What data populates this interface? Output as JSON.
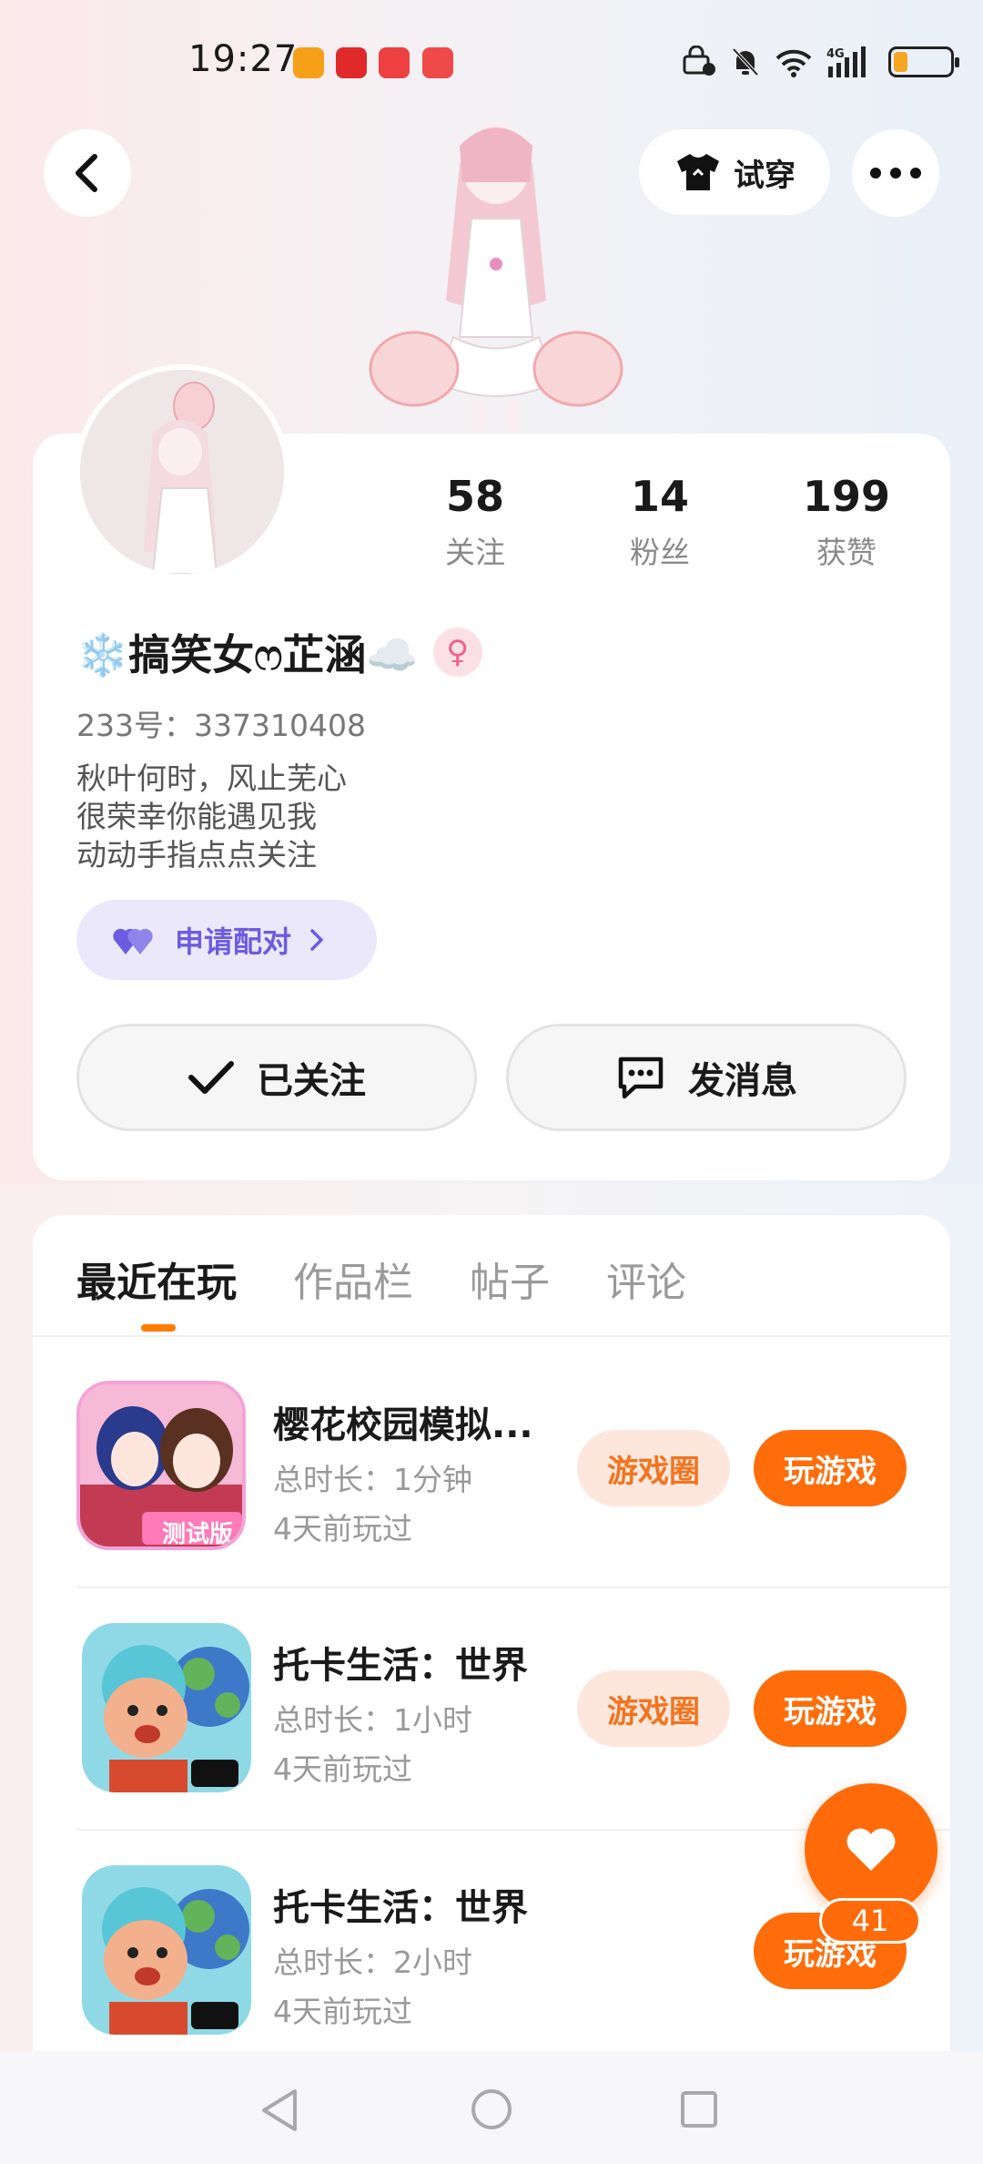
{
  "status_bar": {
    "time": "19:27",
    "battery_level": 0.18,
    "network": "4G"
  },
  "header": {
    "try_on_label": "试穿",
    "icons": {
      "back": "back-arrow-icon",
      "shirt": "shirt-icon",
      "more": "more-icon"
    }
  },
  "profile": {
    "stats": [
      {
        "value": "58",
        "label": "关注"
      },
      {
        "value": "14",
        "label": "粉丝"
      },
      {
        "value": "199",
        "label": "获赞"
      }
    ],
    "nickname": "❄️搞笑女ෆ芷涵☁️",
    "gender_symbol": "♀",
    "uid": "233号：337310408",
    "bio": [
      "秋叶何时，风止芜心",
      "很荣幸你能遇见我",
      "动动手指点点关注"
    ],
    "pair_button": "申请配对",
    "follow_button": "已关注",
    "message_button": "发消息"
  },
  "tabs": [
    "最近在玩",
    "作品栏",
    "帖子",
    "评论"
  ],
  "active_tab": 0,
  "games": [
    {
      "title": "樱花校园模拟...",
      "duration": "总时长：1分钟",
      "last_played": "4天前玩过",
      "icon_badge": "测试版",
      "circle_label": "游戏圈",
      "play_label": "玩游戏"
    },
    {
      "title": "托卡生活：世界",
      "duration": "总时长：1小时",
      "last_played": "4天前玩过",
      "circle_label": "游戏圈",
      "play_label": "玩游戏"
    },
    {
      "title": "托卡生活：世界",
      "duration": "总时长：2小时",
      "last_played": "4天前玩过",
      "play_label": "玩游戏"
    }
  ],
  "like_fab": {
    "count": "41",
    "icon": "heart-icon"
  },
  "nav": {
    "back": "nav-back-icon",
    "home": "nav-home-icon",
    "recents": "nav-recents-icon"
  },
  "colors": {
    "accent": "#ff6d0a",
    "pair": "#6c5ce0",
    "chip_bg": "#fde7dc"
  }
}
